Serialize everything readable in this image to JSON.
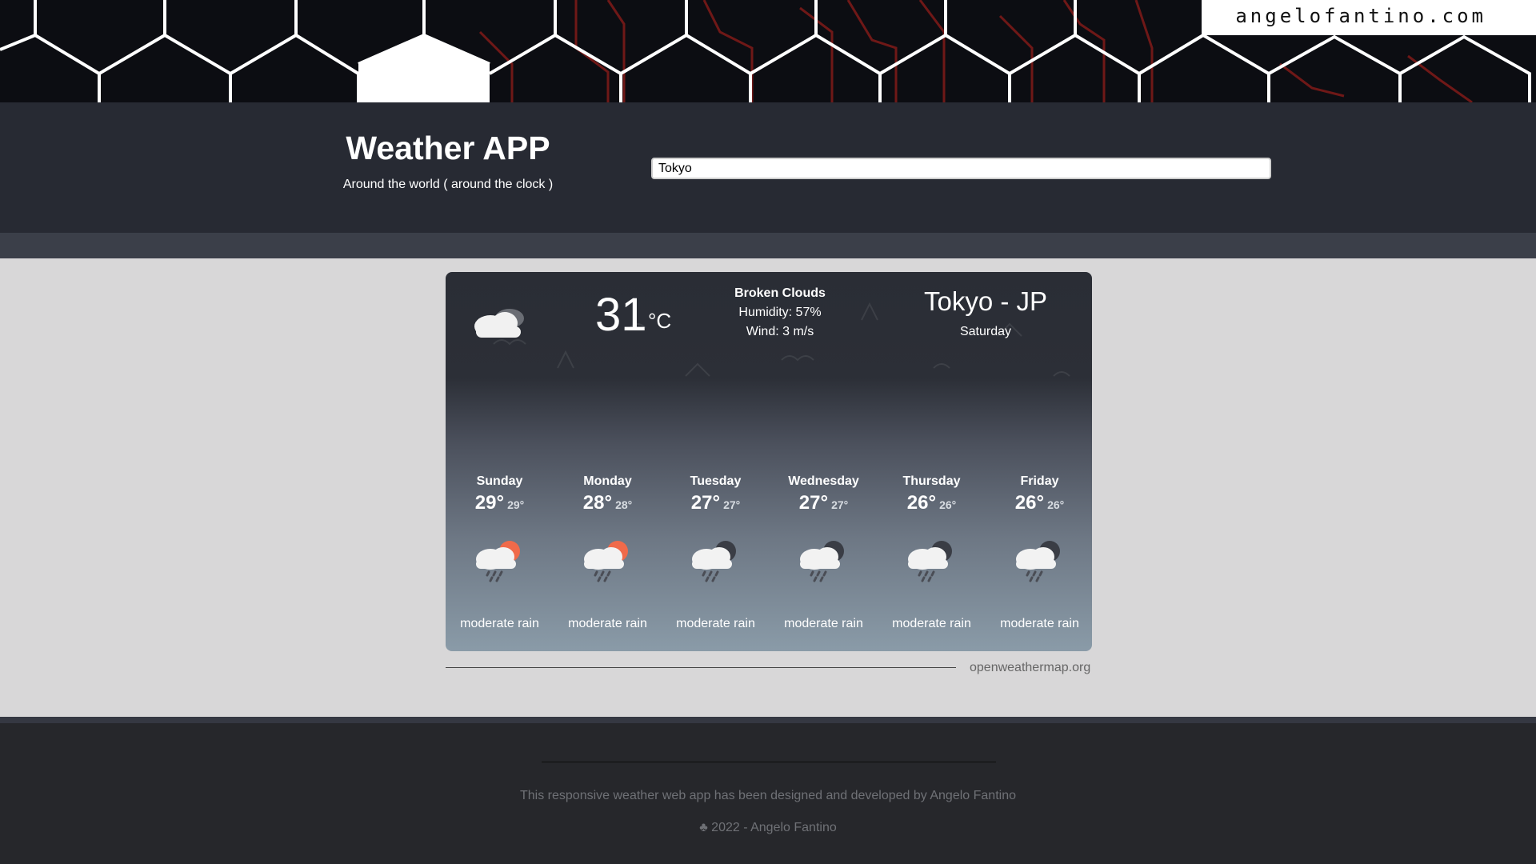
{
  "brand": {
    "text": "angelofantino.com"
  },
  "header": {
    "title": "Weather APP",
    "subtitle": "Around the world ( around the clock )"
  },
  "search": {
    "value": "Tokyo",
    "placeholder": ""
  },
  "current": {
    "temperature": "31",
    "unit": "°C",
    "condition": "Broken Clouds",
    "humidity": "Humidity: 57%",
    "wind": "Wind: 3 m/s",
    "city": "Tokyo - JP",
    "day": "Saturday",
    "icon": "broken-clouds-icon"
  },
  "forecast": [
    {
      "day": "Sunday",
      "max": "29°",
      "min": "29°",
      "desc": "moderate rain",
      "icon": "rain-day-icon"
    },
    {
      "day": "Monday",
      "max": "28°",
      "min": "28°",
      "desc": "moderate rain",
      "icon": "rain-day-icon"
    },
    {
      "day": "Tuesday",
      "max": "27°",
      "min": "27°",
      "desc": "moderate rain",
      "icon": "rain-night-icon"
    },
    {
      "day": "Wednesday",
      "max": "27°",
      "min": "27°",
      "desc": "moderate rain",
      "icon": "rain-night-icon"
    },
    {
      "day": "Thursday",
      "max": "26°",
      "min": "26°",
      "desc": "moderate rain",
      "icon": "rain-night-icon"
    },
    {
      "day": "Friday",
      "max": "26°",
      "min": "26°",
      "desc": "moderate rain",
      "icon": "rain-night-icon"
    }
  ],
  "credit": {
    "text": "openweathermap.org"
  },
  "footer": {
    "line1": "This responsive weather web app has been designed and developed by Angelo Fantino",
    "line2": "♣ 2022 - Angelo Fantino"
  },
  "colors": {
    "header_bg": "#272a33",
    "page_bg": "#d8d7d8",
    "footer_bg": "#26272b",
    "sun": "#f06a4a",
    "moon": "#3a3d45"
  }
}
